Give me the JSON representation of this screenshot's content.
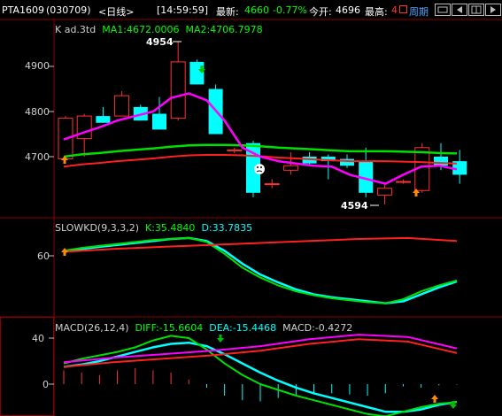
{
  "header": {
    "symbol": "PTA1609",
    "code": "(030709)",
    "period": "<日线>",
    "time": "[14:59:59]",
    "last_label": "最新:",
    "last_value": "4660",
    "change_pct": "-0.77%",
    "open_label": "今开:",
    "open_value": "4696",
    "high_label": "最高:",
    "high_value": "4",
    "period_button": "周期"
  },
  "main": {
    "title": "K ad.3td",
    "ma1_label": "MA1:4672.0006",
    "ma2_label": "MA2:4706.7978",
    "y_ticks": [
      "4900",
      "4800",
      "4700"
    ],
    "high_marker": "4954",
    "low_marker": "4594"
  },
  "kd": {
    "title": "SLOWKD(9,3,3,2)",
    "k_label": "K:35.4840",
    "d_label": "D:33.7835",
    "y_ticks": [
      "60"
    ]
  },
  "macd": {
    "title": "MACD(26,12,4)",
    "diff_label": "DIFF:-15.6604",
    "dea_label": "DEA:-15.4468",
    "macd_label": "MACD:-0.4272",
    "y_ticks": [
      "40",
      "0"
    ]
  },
  "colors": {
    "up": "#ff3232",
    "down": "#00ffff",
    "ma1": "#ff00ff",
    "ma2": "#00e000",
    "red_line": "#ff2020",
    "grid": "#8b0000"
  },
  "chart_data": {
    "type": "candlestick",
    "candles": [
      {
        "o": 4695,
        "h": 4790,
        "l": 4695,
        "c": 4785
      },
      {
        "o": 4740,
        "h": 4795,
        "l": 4700,
        "c": 4790
      },
      {
        "o": 4790,
        "h": 4810,
        "l": 4775,
        "c": 4775
      },
      {
        "o": 4790,
        "h": 4845,
        "l": 4790,
        "c": 4835
      },
      {
        "o": 4810,
        "h": 4815,
        "l": 4780,
        "c": 4780
      },
      {
        "o": 4795,
        "h": 4832,
        "l": 4760,
        "c": 4760
      },
      {
        "o": 4785,
        "h": 4954,
        "l": 4780,
        "c": 4910
      },
      {
        "o": 4910,
        "h": 4915,
        "l": 4860,
        "c": 4860
      },
      {
        "o": 4850,
        "h": 4860,
        "l": 4750,
        "c": 4750
      },
      {
        "o": 4715,
        "h": 4720,
        "l": 4708,
        "c": 4715
      },
      {
        "o": 4730,
        "h": 4735,
        "l": 4610,
        "c": 4620
      },
      {
        "o": 4640,
        "h": 4650,
        "l": 4630,
        "c": 4640
      },
      {
        "o": 4670,
        "h": 4710,
        "l": 4660,
        "c": 4680
      },
      {
        "o": 4700,
        "h": 4710,
        "l": 4680,
        "c": 4685
      },
      {
        "o": 4700,
        "h": 4705,
        "l": 4650,
        "c": 4690
      },
      {
        "o": 4695,
        "h": 4705,
        "l": 4675,
        "c": 4680
      },
      {
        "o": 4690,
        "h": 4720,
        "l": 4610,
        "c": 4620
      },
      {
        "o": 4615,
        "h": 4640,
        "l": 4594,
        "c": 4630
      },
      {
        "o": 4645,
        "h": 4650,
        "l": 4640,
        "c": 4645
      },
      {
        "o": 4625,
        "h": 4730,
        "l": 4620,
        "c": 4720
      },
      {
        "o": 4700,
        "h": 4730,
        "l": 4670,
        "c": 4680
      },
      {
        "o": 4690,
        "h": 4715,
        "l": 4640,
        "c": 4660
      }
    ],
    "ma1": [
      4738,
      4752,
      4765,
      4780,
      4790,
      4800,
      4830,
      4840,
      4825,
      4780,
      4720,
      4700,
      4690,
      4685,
      4680,
      4678,
      4660,
      4650,
      4640,
      4660,
      4678,
      4680,
      4672
    ],
    "ma2": [
      4700,
      4705,
      4708,
      4712,
      4715,
      4718,
      4722,
      4725,
      4726,
      4726,
      4725,
      4723,
      4720,
      4718,
      4716,
      4714,
      4712,
      4712,
      4712,
      4711,
      4710,
      4708,
      4707
    ],
    "kd_k": [
      65,
      68,
      70,
      72,
      74,
      76,
      77,
      78,
      74,
      62,
      48,
      38,
      30,
      24,
      20,
      17,
      15,
      13,
      12,
      16,
      24,
      30,
      35
    ],
    "kd_d": [
      64,
      67,
      69,
      71,
      73,
      75,
      77,
      78,
      75,
      65,
      52,
      41,
      33,
      26,
      21,
      18,
      16,
      14,
      12,
      14,
      21,
      28,
      34
    ],
    "macd_diff": [
      18,
      22,
      25,
      28,
      32,
      38,
      42,
      40,
      30,
      18,
      8,
      0,
      -5,
      -10,
      -14,
      -18,
      -22,
      -26,
      -28,
      -24,
      -20,
      -17,
      -15.66
    ],
    "macd_dea": [
      15,
      17,
      20,
      24,
      28,
      32,
      35,
      36,
      33,
      26,
      18,
      10,
      3,
      -3,
      -8,
      -12,
      -16,
      -20,
      -24,
      -24,
      -22,
      -18,
      -15.45
    ],
    "macd_hist": [
      12,
      10,
      8,
      12,
      14,
      12,
      10,
      4,
      -3,
      -10,
      -14,
      -15,
      -12,
      -10,
      -9,
      -8,
      -9,
      -10,
      -8,
      -2,
      -3,
      -1,
      -0.43
    ]
  }
}
